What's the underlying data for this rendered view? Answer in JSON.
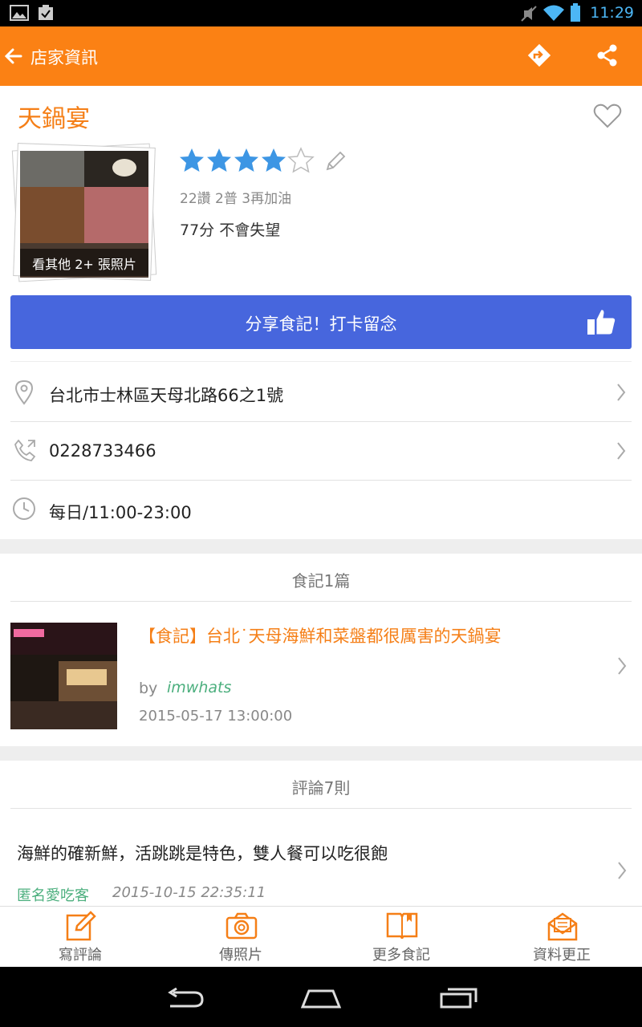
{
  "status_bar": {
    "time": "11:29"
  },
  "app_bar": {
    "title": "店家資訊"
  },
  "store": {
    "name": "天鍋宴",
    "rating": 4,
    "rating_max": 5,
    "votes": "22讚 2普 3再加油",
    "score": "77分 不會失望",
    "photo_overlay": "看其他 2+ 張照片"
  },
  "share_button": {
    "label": "分享食記！打卡留念"
  },
  "info": {
    "address": "台北市士林區天母北路66之1號",
    "phone": "0228733466",
    "hours": "每日/11:00-23:00"
  },
  "blog_section": {
    "title": "食記1篇",
    "posts": [
      {
        "title": "【食記】台北˙天母海鮮和菜盤都很厲害的天鍋宴",
        "by": "by",
        "author": "imwhats",
        "date": "2015-05-17 13:00:00"
      }
    ]
  },
  "review_section": {
    "title": "評論7則",
    "reviews": [
      {
        "text": "海鮮的確新鮮，活跳跳是特色，雙人餐可以吃很飽",
        "author": "匿名愛吃客",
        "date": "2015-10-15 22:35:11"
      }
    ]
  },
  "bottom_nav": {
    "write_review": "寫評論",
    "upload_photo": "傳照片",
    "more_blogs": "更多食記",
    "correct_info": "資料更正"
  },
  "colors": {
    "accent": "#fb8114",
    "share": "#4766dd",
    "star": "#3d96e4",
    "author": "#4caf7e"
  }
}
